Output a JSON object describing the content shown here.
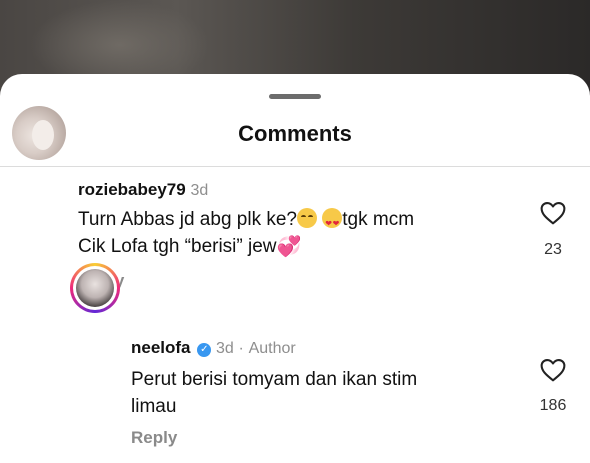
{
  "sheet": {
    "title": "Comments"
  },
  "comments": [
    {
      "username": "roziebabey79",
      "time": "3d",
      "text_part1": "Turn Abbas jd abg plk ke?",
      "text_part2": "tgk mcm",
      "text_part3": "Cik Lofa tgh “berisi” jew",
      "emoji_1": "relieved-face-emoji",
      "emoji_2": "smiling-heart-eyes-emoji",
      "emoji_3": "sparkling-heart-emoji",
      "like_count": "23",
      "reply_label": "Reply"
    },
    {
      "username": "neelofa",
      "time": "3d",
      "separator": "·",
      "author_label": "Author",
      "verified": true,
      "text_line1": "Perut berisi tomyam dan ikan stim",
      "text_line2": "limau",
      "like_count": "186",
      "reply_label": "Reply"
    }
  ],
  "colors": {
    "verified_badge": "#3897f0",
    "story_ring": [
      "#f9ce34",
      "#ee2a7b",
      "#6228d7"
    ]
  }
}
